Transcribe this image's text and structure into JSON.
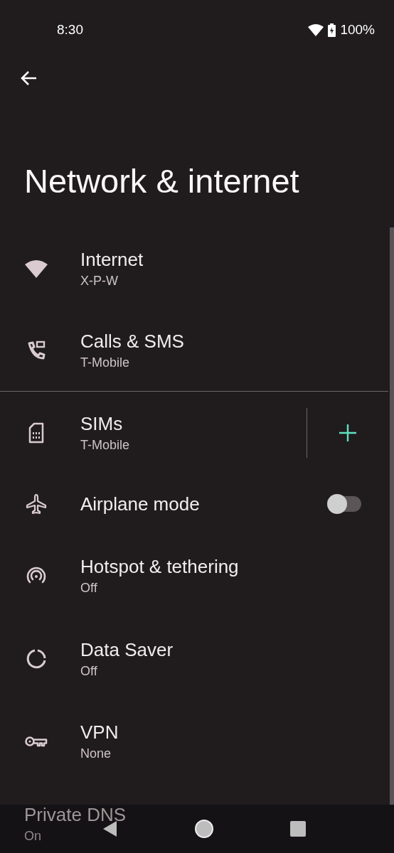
{
  "status_bar": {
    "time": "8:30",
    "battery": "100%"
  },
  "title": "Network & internet",
  "sections": [
    [
      {
        "kind": "link",
        "title": "Internet",
        "summary": "X-P-W"
      },
      {
        "kind": "link",
        "title": "Calls & SMS",
        "summary": "T-Mobile"
      }
    ],
    [
      {
        "kind": "add",
        "title": "SIMs",
        "summary": "T-Mobile"
      },
      {
        "kind": "switch",
        "title": "Airplane mode",
        "on": false
      },
      {
        "kind": "link",
        "title": "Hotspot & tethering",
        "summary": "Off"
      },
      {
        "kind": "link",
        "title": "Data Saver",
        "summary": "Off"
      },
      {
        "kind": "link",
        "title": "VPN",
        "summary": "None"
      },
      {
        "kind": "plain",
        "title": "Private DNS",
        "summary": "On"
      }
    ]
  ]
}
